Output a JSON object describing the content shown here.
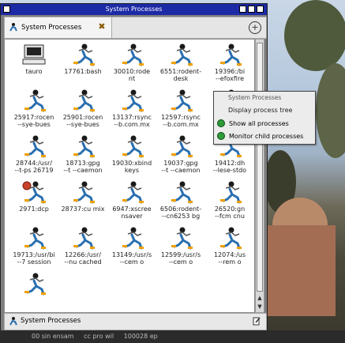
{
  "window": {
    "title": "System Processes"
  },
  "tab": {
    "label": "System Processes"
  },
  "status": {
    "label": "System Processes"
  },
  "popup": {
    "title": "System Processes",
    "heading": "Display process tree",
    "items": [
      {
        "label": "Show all processes"
      },
      {
        "label": "Monitor child processes"
      }
    ]
  },
  "processes": [
    {
      "label": "tauro",
      "kind": "computer"
    },
    {
      "label": "17761:bash",
      "kind": "runner"
    },
    {
      "label": "30010:rode\nnt",
      "kind": "runner"
    },
    {
      "label": "6551:rodent-\ndesk",
      "kind": "runner"
    },
    {
      "label": "19396:/bi\n--efoxfire",
      "kind": "runner"
    },
    {
      "label": "25917:rocen\n--sye-bues",
      "kind": "runner"
    },
    {
      "label": "25901:rocen\n--sye-bues",
      "kind": "runner"
    },
    {
      "label": "13137:rsync\n--b.com.mx",
      "kind": "runner"
    },
    {
      "label": "12597:rsync\n--b.com.mx",
      "kind": "runner"
    },
    {
      "label": "",
      "kind": "runner"
    },
    {
      "label": "28744:/usr/\n--t-ps 26719",
      "kind": "runner"
    },
    {
      "label": "18713:gpg\n--t --caemon",
      "kind": "runner"
    },
    {
      "label": "19030:xbind\nkeys",
      "kind": "runner"
    },
    {
      "label": "19037:gpg\n--t --caemon",
      "kind": "runner"
    },
    {
      "label": "19412:dh\n--lese-stdo",
      "kind": "runner"
    },
    {
      "label": "2971:dcp",
      "kind": "runner-red"
    },
    {
      "label": "28737:cu mix",
      "kind": "runner"
    },
    {
      "label": "6947:xscree\nnsaver",
      "kind": "runner"
    },
    {
      "label": "6506:rodent-\n--cn6253 bg",
      "kind": "runner"
    },
    {
      "label": "26520:gn\n--fcm cnu",
      "kind": "runner"
    },
    {
      "label": "19713:/usr/bi\n--7 session",
      "kind": "runner"
    },
    {
      "label": "12266:/usr/\n--nu cached",
      "kind": "runner"
    },
    {
      "label": "13149:/usr/s\n--cem o",
      "kind": "runner"
    },
    {
      "label": "12599:/usr/s\n--cem o",
      "kind": "runner"
    },
    {
      "label": "12074:/us\n--rem o",
      "kind": "runner"
    },
    {
      "label": "",
      "kind": "runner"
    },
    {
      "label": "",
      "kind": "blank"
    },
    {
      "label": "",
      "kind": "blank"
    },
    {
      "label": "",
      "kind": "blank"
    },
    {
      "label": "",
      "kind": "blank"
    }
  ],
  "taskbar": {
    "items": [
      "00 sin ensam",
      "cc pro wil",
      "100028 ep"
    ]
  }
}
